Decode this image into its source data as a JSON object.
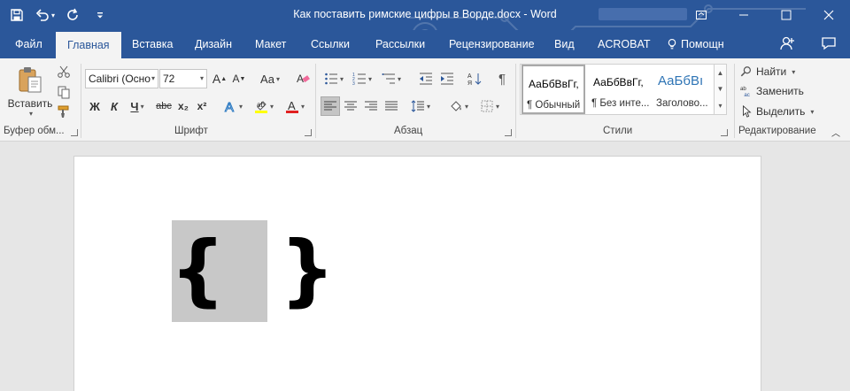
{
  "window": {
    "title": "Как поставить римские цифры в Ворде.docx - Word"
  },
  "tabs": [
    {
      "label": "Файл"
    },
    {
      "label": "Главная"
    },
    {
      "label": "Вставка"
    },
    {
      "label": "Дизайн"
    },
    {
      "label": "Макет"
    },
    {
      "label": "Ссылки"
    },
    {
      "label": "Рассылки"
    },
    {
      "label": "Рецензирование"
    },
    {
      "label": "Вид"
    },
    {
      "label": "ACROBAT"
    }
  ],
  "tell_me": {
    "label": "Помощн"
  },
  "ribbon": {
    "clipboard": {
      "paste_label": "Вставить",
      "group_label": "Буфер обм..."
    },
    "font": {
      "font_name": "Calibri (Осно",
      "font_size": "72",
      "bold": "Ж",
      "italic": "К",
      "underline": "Ч",
      "strike": "abc",
      "subscript": "x₂",
      "superscript": "x²",
      "grow": "A",
      "shrink": "A",
      "case": "Aa",
      "group_label": "Шрифт"
    },
    "paragraph": {
      "pilcrow": "¶",
      "group_label": "Абзац"
    },
    "styles": {
      "items": [
        {
          "preview": "АаБбВвГг,",
          "name": "¶ Обычный"
        },
        {
          "preview": "АаБбВвГг,",
          "name": "¶ Без инте..."
        },
        {
          "preview": "АаБбВı",
          "name": "Заголово..."
        }
      ],
      "group_label": "Стили"
    },
    "editing": {
      "find": "Найти",
      "replace": "Заменить",
      "select": "Выделить",
      "group_label": "Редактирование"
    }
  },
  "document": {
    "content": "{  }"
  },
  "colors": {
    "brand": "#2b579a",
    "ribbon_bg": "#f3f3f3",
    "selection": "#c8c8c8"
  }
}
